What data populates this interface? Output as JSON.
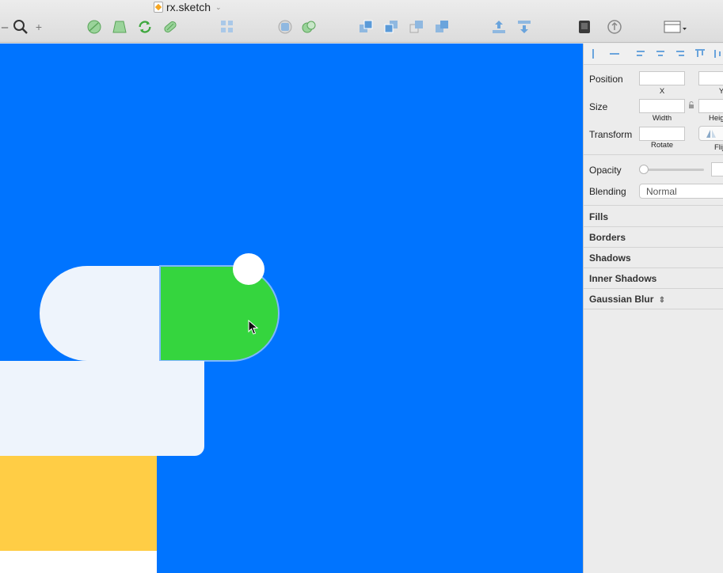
{
  "window": {
    "title": "rx.sketch"
  },
  "toolbar": {
    "zoom_out_label": "–",
    "zoom_in_label": "+",
    "icons": [
      "zoom-icon",
      "union-icon",
      "transform-icon",
      "rotate-copies-icon",
      "flatten-icon",
      "grid-icon",
      "mask-icon",
      "scissors-icon",
      "forward-icon",
      "backward-icon",
      "intersect-icon",
      "difference-icon",
      "export-icon",
      "import-icon",
      "mirror-icon",
      "cloud-icon",
      "view-icon"
    ]
  },
  "inspector": {
    "position": {
      "label": "Position",
      "x_label": "X",
      "y_label": "Y",
      "x_value": "",
      "y_value": ""
    },
    "size": {
      "label": "Size",
      "width_label": "Width",
      "height_label": "Heig",
      "width_value": "",
      "height_value": ""
    },
    "transform": {
      "label": "Transform",
      "rotate_label": "Rotate",
      "flip_label": "Flij",
      "rotate_value": ""
    },
    "opacity": {
      "label": "Opacity",
      "level": 0
    },
    "blending": {
      "label": "Blending",
      "value": "Normal"
    },
    "sections": {
      "fills": "Fills",
      "borders": "Borders",
      "shadows": "Shadows",
      "inner_shadows": "Inner Shadows",
      "gaussian_blur": "Gaussian Blur"
    }
  },
  "colors": {
    "canvas": "#0074ff",
    "light_shape": "#eef4fc",
    "green_shape": "#35d53e",
    "yellow_shape": "#ffcd45",
    "selection": "#7fb7ff"
  }
}
